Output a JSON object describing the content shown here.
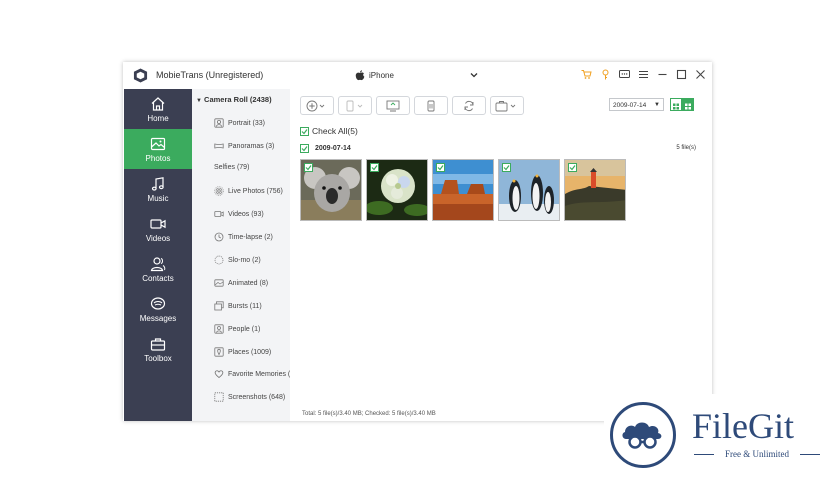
{
  "app": {
    "title": "MobieTrans (Unregistered)",
    "device": "iPhone"
  },
  "nav": [
    {
      "label": "Home",
      "icon": "home-icon"
    },
    {
      "label": "Photos",
      "icon": "photos-icon",
      "active": true
    },
    {
      "label": "Music",
      "icon": "music-icon"
    },
    {
      "label": "Videos",
      "icon": "videos-icon"
    },
    {
      "label": "Contacts",
      "icon": "contacts-icon"
    },
    {
      "label": "Messages",
      "icon": "messages-icon"
    },
    {
      "label": "Toolbox",
      "icon": "toolbox-icon"
    }
  ],
  "albums": {
    "header": "Camera Roll (2438)",
    "items": [
      {
        "label": "Portrait (33)",
        "icon": "portrait-icon"
      },
      {
        "label": "Panoramas (3)",
        "icon": "panorama-icon"
      },
      {
        "label": "Selfies (79)",
        "icon": ""
      },
      {
        "label": "Live Photos (756)",
        "icon": "live-photo-icon"
      },
      {
        "label": "Videos (93)",
        "icon": "video-icon"
      },
      {
        "label": "Time-lapse (2)",
        "icon": "timelapse-icon"
      },
      {
        "label": "Slo-mo (2)",
        "icon": "slomo-icon"
      },
      {
        "label": "Animated (8)",
        "icon": "animated-icon"
      },
      {
        "label": "Bursts (11)",
        "icon": "bursts-icon"
      },
      {
        "label": "People (1)",
        "icon": "people-icon"
      },
      {
        "label": "Places (1009)",
        "icon": "places-icon"
      },
      {
        "label": "Favorite Memories (...",
        "icon": "heart-icon"
      },
      {
        "label": "Screenshots (648)",
        "icon": "screenshot-icon"
      }
    ]
  },
  "content": {
    "date_filter": "2009-07-14",
    "check_all": "Check All(5)",
    "group_date": "2009-07-14",
    "file_count": "5 file(s)",
    "status": "Total: 5 file(s)/3.40 MB; Checked: 5 file(s)/3.40 MB"
  },
  "watermark": {
    "name": "FileGit",
    "tagline": "Free & Unlimited"
  },
  "colors": {
    "accent": "#3bab5e",
    "sidebar": "#3b3f52",
    "brand": "#2e4a79"
  }
}
